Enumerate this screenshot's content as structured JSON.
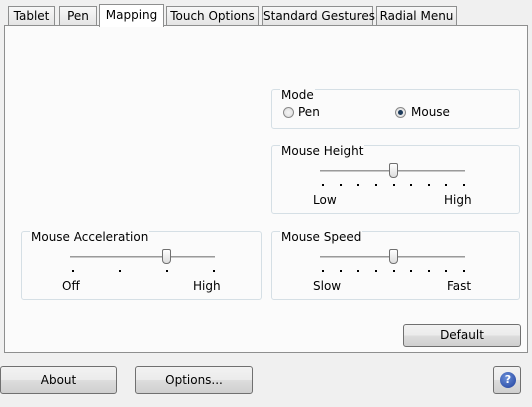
{
  "tabs": [
    {
      "label": "Tablet"
    },
    {
      "label": "Pen"
    },
    {
      "label": "Mapping",
      "active": true
    },
    {
      "label": "Touch Options"
    },
    {
      "label": "Standard Gestures"
    },
    {
      "label": "Radial Menu"
    }
  ],
  "mode": {
    "title": "Mode",
    "options": [
      {
        "label": "Pen",
        "checked": false
      },
      {
        "label": "Mouse",
        "checked": true
      }
    ]
  },
  "mouse_height": {
    "title": "Mouse Height",
    "min_label": "Low",
    "max_label": "High",
    "ticks": 9,
    "value_index": 4
  },
  "mouse_acceleration": {
    "title": "Mouse Acceleration",
    "min_label": "Off",
    "max_label": "High",
    "ticks": 4,
    "value_index": 2
  },
  "mouse_speed": {
    "title": "Mouse Speed",
    "min_label": "Slow",
    "max_label": "Fast",
    "ticks": 9,
    "value_index": 4
  },
  "buttons": {
    "default": "Default",
    "about": "About",
    "options": "Options...",
    "help_icon": "question-mark-icon",
    "help_glyph": "?"
  },
  "colors": {
    "help_icon": "#2a4fb0",
    "panel_border": "#8e8f8f",
    "group_border": "#d5dfe5"
  }
}
